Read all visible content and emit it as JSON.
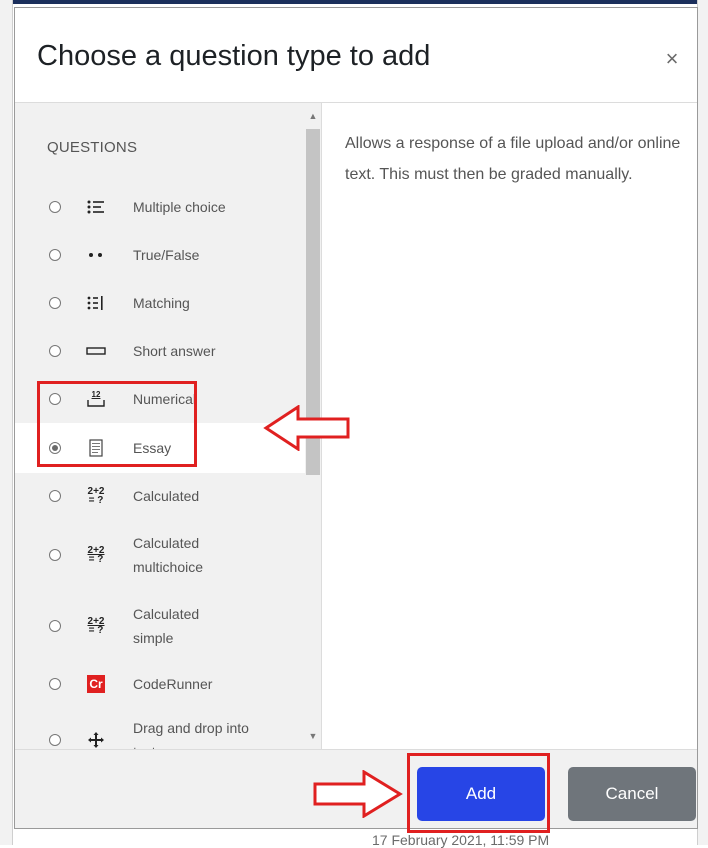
{
  "background": {
    "bottom_text": "17 February 2021, 11:59 PM"
  },
  "modal": {
    "title": "Choose a question type to add",
    "close_glyph": "×",
    "section_label": "QUESTIONS",
    "options": [
      {
        "label": "Multiple choice",
        "icon": "list-icon",
        "selected": false
      },
      {
        "label": "True/False",
        "icon": "two-dots-icon",
        "selected": false
      },
      {
        "label": "Matching",
        "icon": "matching-icon",
        "selected": false
      },
      {
        "label": "Short answer",
        "icon": "short-answer-icon",
        "selected": false
      },
      {
        "label": "Numerical",
        "icon": "numerical-icon",
        "selected": false
      },
      {
        "label": "Essay",
        "icon": "essay-icon",
        "selected": true
      },
      {
        "label": "Calculated",
        "icon": "calculated-icon",
        "selected": false
      },
      {
        "label": "Calculated multichoice",
        "icon": "calculated-icon",
        "selected": false
      },
      {
        "label": "Calculated simple",
        "icon": "calculated-simple-icon",
        "selected": false
      },
      {
        "label": "CodeRunner",
        "icon": "coderunner-icon",
        "selected": false
      },
      {
        "label": "Drag and drop into text",
        "icon": "move-icon",
        "selected": false
      }
    ],
    "icon_text": {
      "numerical": "12",
      "calculated_top": "2+2",
      "calculated_bottom": "= ?",
      "coderunner": "Cr"
    },
    "description": "Allows a response of a file upload and/or online text. This must then be graded manually.",
    "buttons": {
      "add": "Add",
      "cancel": "Cancel"
    }
  },
  "colors": {
    "primary_button": "#2745e6",
    "secondary_button": "#6f757b",
    "annotation": "#e02020"
  }
}
